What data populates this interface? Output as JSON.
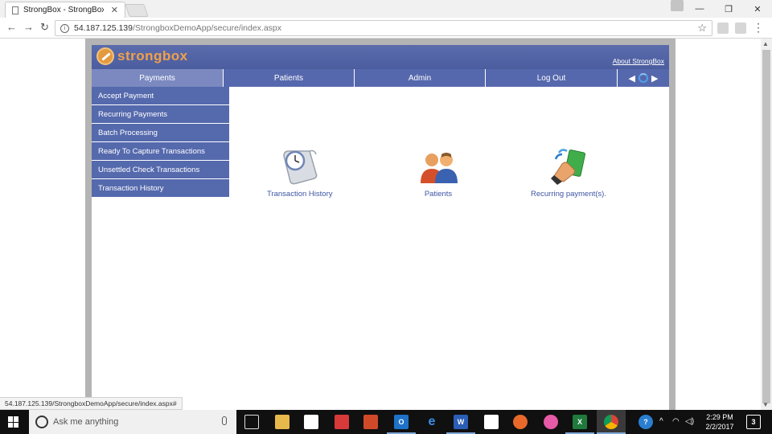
{
  "browser": {
    "tab_title": "StrongBox - StrongBoxD",
    "url_host": "54.187.125.139",
    "url_path": "/StrongboxDemoApp/secure/index.aspx",
    "status_url": "54.187.125.139/StrongboxDemoApp/secure/index.aspx#"
  },
  "app": {
    "logo_text": "strongbox",
    "about_link": "About StrongBox",
    "menu": [
      {
        "label": "Payments"
      },
      {
        "label": "Patients"
      },
      {
        "label": "Admin"
      },
      {
        "label": "Log Out"
      }
    ],
    "submenu": [
      {
        "label": "Accept Payment"
      },
      {
        "label": "Recurring Payments"
      },
      {
        "label": "Batch Processing"
      },
      {
        "label": "Ready To Capture Transactions"
      },
      {
        "label": "Unsettled Check Transactions"
      },
      {
        "label": "Transaction History"
      }
    ],
    "tiles": [
      {
        "label": "Transaction History",
        "icon": "scroll-clock-icon"
      },
      {
        "label": "Patients",
        "icon": "people-icon"
      },
      {
        "label": "Recurring payment(s).",
        "icon": "hand-money-icon"
      }
    ]
  },
  "taskbar": {
    "search_placeholder": "Ask me anything",
    "time": "2:29 PM",
    "date": "2/2/2017",
    "notification_count": "3"
  },
  "colors": {
    "header": "#4c5d9f",
    "menu": "#5668ad",
    "menu_active": "#7b89c0",
    "link": "#3e55a3",
    "logo": "#f1a04a"
  }
}
